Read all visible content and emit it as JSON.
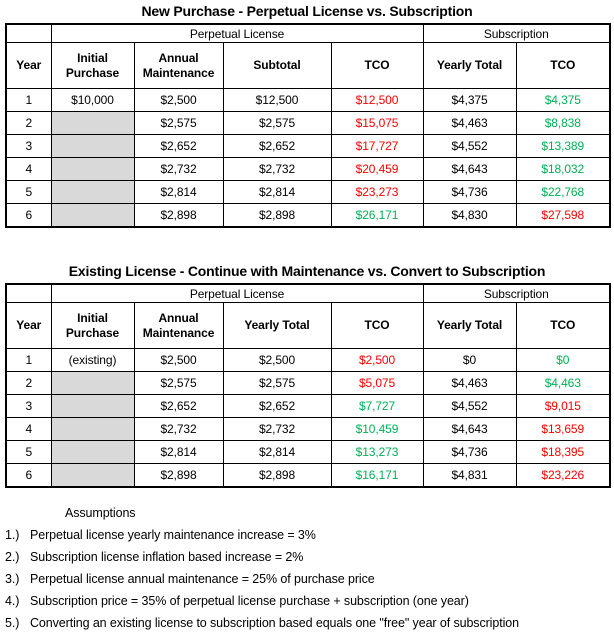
{
  "colors": {
    "red": "#ff0000",
    "green": "#00b254",
    "shaded_cell": "#d9d9d9",
    "border": "#000000"
  },
  "tables": [
    {
      "title": "New Purchase - Perpetual License vs. Subscription",
      "group_headers": {
        "blank": "",
        "perpetual": "Perpetual License",
        "subscription": "Subscription"
      },
      "columns": [
        "Year",
        "Initial\nPurchase",
        "Annual\nMaintenance",
        "Subtotal",
        "TCO",
        "Yearly Total",
        "TCO"
      ],
      "columns_split": [
        [
          "Year",
          ""
        ],
        [
          "Initial",
          "Purchase"
        ],
        [
          "Annual",
          "Maintenance"
        ],
        [
          "Subtotal",
          ""
        ],
        [
          "TCO",
          ""
        ],
        [
          "Yearly Total",
          ""
        ],
        [
          "TCO",
          ""
        ]
      ],
      "rows": [
        {
          "year": "1",
          "initial_purchase": "$10,000",
          "initial_shaded": false,
          "annual_maintenance": "$2,500",
          "perp_total": "$12,500",
          "perp_tco": "$12,500",
          "perp_tco_color": "red",
          "sub_yearly": "$4,375",
          "sub_tco": "$4,375",
          "sub_tco_color": "green"
        },
        {
          "year": "2",
          "initial_purchase": "",
          "initial_shaded": true,
          "annual_maintenance": "$2,575",
          "perp_total": "$2,575",
          "perp_tco": "$15,075",
          "perp_tco_color": "red",
          "sub_yearly": "$4,463",
          "sub_tco": "$8,838",
          "sub_tco_color": "green"
        },
        {
          "year": "3",
          "initial_purchase": "",
          "initial_shaded": true,
          "annual_maintenance": "$2,652",
          "perp_total": "$2,652",
          "perp_tco": "$17,727",
          "perp_tco_color": "red",
          "sub_yearly": "$4,552",
          "sub_tco": "$13,389",
          "sub_tco_color": "green"
        },
        {
          "year": "4",
          "initial_purchase": "",
          "initial_shaded": true,
          "annual_maintenance": "$2,732",
          "perp_total": "$2,732",
          "perp_tco": "$20,459",
          "perp_tco_color": "red",
          "sub_yearly": "$4,643",
          "sub_tco": "$18,032",
          "sub_tco_color": "green"
        },
        {
          "year": "5",
          "initial_purchase": "",
          "initial_shaded": true,
          "annual_maintenance": "$2,814",
          "perp_total": "$2,814",
          "perp_tco": "$23,273",
          "perp_tco_color": "red",
          "sub_yearly": "$4,736",
          "sub_tco": "$22,768",
          "sub_tco_color": "green"
        },
        {
          "year": "6",
          "initial_purchase": "",
          "initial_shaded": true,
          "annual_maintenance": "$2,898",
          "perp_total": "$2,898",
          "perp_tco": "$26,171",
          "perp_tco_color": "green",
          "sub_yearly": "$4,830",
          "sub_tco": "$27,598",
          "sub_tco_color": "red"
        }
      ]
    },
    {
      "title": "Existing License - Continue with Maintenance vs. Convert to Subscription",
      "group_headers": {
        "blank": "",
        "perpetual": "Perpetual License",
        "subscription": "Subscription"
      },
      "columns": [
        "Year",
        "Initial\nPurchase",
        "Annual\nMaintenance",
        "Yearly Total",
        "TCO",
        "Yearly Total",
        "TCO"
      ],
      "columns_split": [
        [
          "Year",
          ""
        ],
        [
          "Initial",
          "Purchase"
        ],
        [
          "Annual",
          "Maintenance"
        ],
        [
          "Yearly Total",
          ""
        ],
        [
          "TCO",
          ""
        ],
        [
          "Yearly Total",
          ""
        ],
        [
          "TCO",
          ""
        ]
      ],
      "rows": [
        {
          "year": "1",
          "initial_purchase": "(existing)",
          "initial_shaded": false,
          "annual_maintenance": "$2,500",
          "perp_total": "$2,500",
          "perp_tco": "$2,500",
          "perp_tco_color": "red",
          "sub_yearly": "$0",
          "sub_tco": "$0",
          "sub_tco_color": "green"
        },
        {
          "year": "2",
          "initial_purchase": "",
          "initial_shaded": true,
          "annual_maintenance": "$2,575",
          "perp_total": "$2,575",
          "perp_tco": "$5,075",
          "perp_tco_color": "red",
          "sub_yearly": "$4,463",
          "sub_tco": "$4,463",
          "sub_tco_color": "green"
        },
        {
          "year": "3",
          "initial_purchase": "",
          "initial_shaded": true,
          "annual_maintenance": "$2,652",
          "perp_total": "$2,652",
          "perp_tco": "$7,727",
          "perp_tco_color": "green",
          "sub_yearly": "$4,552",
          "sub_tco": "$9,015",
          "sub_tco_color": "red"
        },
        {
          "year": "4",
          "initial_purchase": "",
          "initial_shaded": true,
          "annual_maintenance": "$2,732",
          "perp_total": "$2,732",
          "perp_tco": "$10,459",
          "perp_tco_color": "green",
          "sub_yearly": "$4,643",
          "sub_tco": "$13,659",
          "sub_tco_color": "red"
        },
        {
          "year": "5",
          "initial_purchase": "",
          "initial_shaded": true,
          "annual_maintenance": "$2,814",
          "perp_total": "$2,814",
          "perp_tco": "$13,273",
          "perp_tco_color": "green",
          "sub_yearly": "$4,736",
          "sub_tco": "$18,395",
          "sub_tco_color": "red"
        },
        {
          "year": "6",
          "initial_purchase": "",
          "initial_shaded": true,
          "annual_maintenance": "$2,898",
          "perp_total": "$2,898",
          "perp_tco": "$16,171",
          "perp_tco_color": "green",
          "sub_yearly": "$4,831",
          "sub_tco": "$23,226",
          "sub_tco_color": "red"
        }
      ]
    }
  ],
  "assumptions": {
    "heading": "Assumptions",
    "items": [
      {
        "num": "1.)",
        "text": "Perpetual license yearly maintenance increase = 3%"
      },
      {
        "num": "2.)",
        "text": "Subscription license inflation based increase = 2%"
      },
      {
        "num": "3.)",
        "text": "Perpetual license annual maintenance = 25% of purchase price"
      },
      {
        "num": "4.)",
        "text": "Subscription price = 35% of perpetual license purchase + subscription (one year)"
      },
      {
        "num": "5.)",
        "text": "Converting an existing license to subscription based equals one \"free\" year of subscription"
      }
    ]
  },
  "chart_data": {
    "type": "table",
    "title": "Perpetual License vs. Subscription TCO comparison",
    "tables": [
      {
        "name": "New Purchase - Perpetual License vs. Subscription",
        "categories": [
          "1",
          "2",
          "3",
          "4",
          "5",
          "6"
        ],
        "xlabel": "Year",
        "series": [
          {
            "name": "Initial Purchase",
            "values": [
              10000,
              null,
              null,
              null,
              null,
              null
            ]
          },
          {
            "name": "Annual Maintenance",
            "values": [
              2500,
              2575,
              2652,
              2732,
              2814,
              2898
            ]
          },
          {
            "name": "Subtotal",
            "values": [
              12500,
              2575,
              2652,
              2732,
              2814,
              2898
            ]
          },
          {
            "name": "Perpetual TCO",
            "values": [
              12500,
              15075,
              17727,
              20459,
              23273,
              26171
            ]
          },
          {
            "name": "Subscription Yearly Total",
            "values": [
              4375,
              4463,
              4552,
              4643,
              4736,
              4830
            ]
          },
          {
            "name": "Subscription TCO",
            "values": [
              4375,
              8838,
              13389,
              18032,
              22768,
              27598
            ]
          }
        ]
      },
      {
        "name": "Existing License - Continue with Maintenance vs. Convert to Subscription",
        "categories": [
          "1",
          "2",
          "3",
          "4",
          "5",
          "6"
        ],
        "xlabel": "Year",
        "series": [
          {
            "name": "Annual Maintenance",
            "values": [
              2500,
              2575,
              2652,
              2732,
              2814,
              2898
            ]
          },
          {
            "name": "Perpetual Yearly Total",
            "values": [
              2500,
              2575,
              2652,
              2732,
              2814,
              2898
            ]
          },
          {
            "name": "Perpetual TCO",
            "values": [
              2500,
              5075,
              7727,
              10459,
              13273,
              16171
            ]
          },
          {
            "name": "Subscription Yearly Total",
            "values": [
              0,
              4463,
              4552,
              4643,
              4736,
              4831
            ]
          },
          {
            "name": "Subscription TCO",
            "values": [
              0,
              4463,
              9015,
              13659,
              18395,
              23226
            ]
          }
        ]
      }
    ]
  }
}
